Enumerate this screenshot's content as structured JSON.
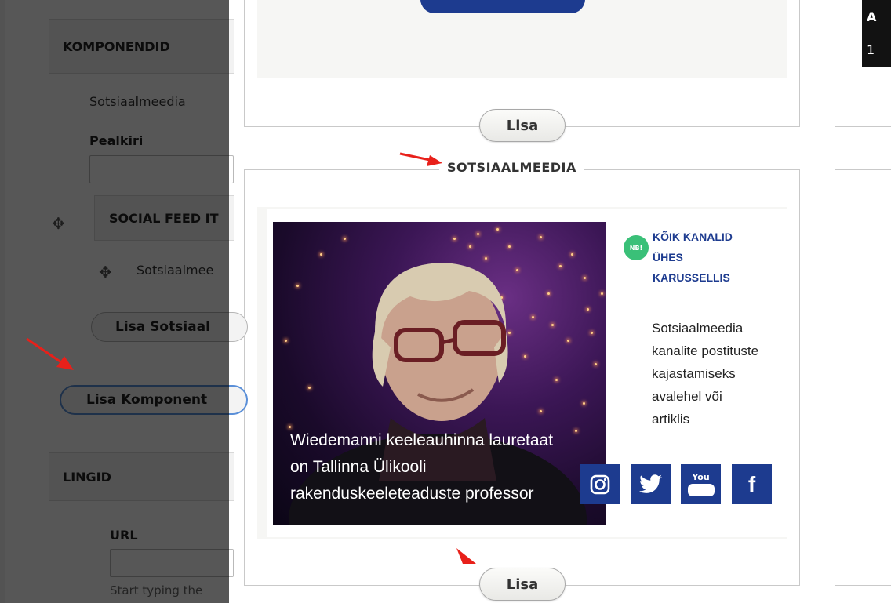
{
  "left_panel": {
    "components_header": "KOMPONENDID",
    "component_type": "Sotsiaalmeedia",
    "title_label": "Pealkiri",
    "title_value": "",
    "social_feed_header": "SOCIAL FEED IT",
    "social_feed_item": "Sotsiaalmee",
    "add_social_button": "Lisa Sotsiaal",
    "add_component_button": "Lisa Komponent",
    "links_header": "LINGID",
    "url_label": "URL",
    "url_value": "",
    "url_hint": "Start typing the"
  },
  "cards": {
    "top_add_button": "Lisa",
    "section_title": "SOTSIAALMEEDIA",
    "bottom_add_button": "Lisa",
    "right_preview_title_fragment": "A",
    "right_preview_number_fragment": "1"
  },
  "preview": {
    "photo_caption_lines": [
      "Wiedemanni keeleauhinna lauretaat",
      "on Tallinna Ülikooli",
      "rakenduskeeleteaduste professor"
    ],
    "badge": "NB!",
    "promo_title_lines": [
      "KÕIK KANALID",
      "ÜHES",
      "KARUSSELLIS"
    ],
    "promo_desc_lines": [
      "Sotsiaalmeedia",
      "kanalite postituste",
      "kajastamiseks",
      "avalehel või",
      "artiklis"
    ],
    "social_icons": [
      {
        "name": "instagram-icon",
        "glyph": "◎"
      },
      {
        "name": "twitter-icon",
        "glyph": "🐦"
      },
      {
        "name": "youtube-icon",
        "glyph": "You"
      },
      {
        "name": "facebook-icon",
        "glyph": "f"
      }
    ],
    "colors": {
      "brand_blue": "#1d3b8f",
      "badge_green": "#3ac078",
      "arrow_red": "#e8201a"
    }
  }
}
